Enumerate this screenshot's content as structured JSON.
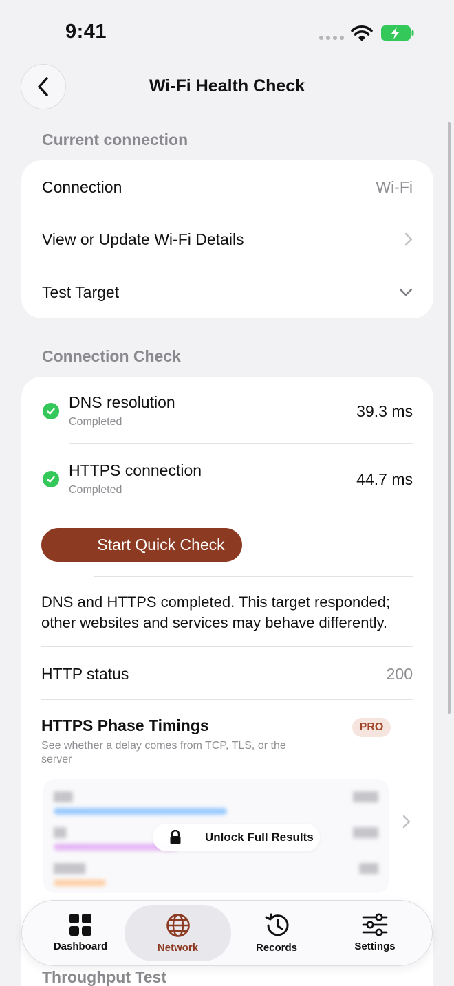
{
  "status_bar": {
    "time": "9:41"
  },
  "nav": {
    "title": "Wi-Fi Health Check",
    "back_icon": "chevron-left-icon"
  },
  "current_connection": {
    "section_label": "Current connection",
    "rows": [
      {
        "label": "Connection",
        "value": "Wi-Fi"
      },
      {
        "label": "View or Update Wi-Fi Details",
        "value": ""
      },
      {
        "label": "Test Target",
        "value": ""
      }
    ]
  },
  "connection_check": {
    "section_label": "Connection Check",
    "items": [
      {
        "name": "DNS resolution",
        "status": "Completed",
        "time": "39.3 ms"
      },
      {
        "name": "HTTPS connection",
        "status": "Completed",
        "time": "44.7 ms"
      }
    ],
    "button_label": "Start Quick Check",
    "summary": "DNS and HTTPS completed. This target responded; other websites and services may behave differently.",
    "http_status_label": "HTTP status",
    "http_status_value": "200",
    "phase_timings": {
      "title": "HTTPS Phase Timings",
      "badge": "PRO",
      "description": "See whether a delay comes from TCP, TLS, or the server",
      "unlock_label": "Unlock Full Results"
    }
  },
  "tab_bar": {
    "tabs": [
      {
        "label": "Dashboard",
        "icon": "grid-icon"
      },
      {
        "label": "Network",
        "icon": "globe-icon"
      },
      {
        "label": "Records",
        "icon": "history-icon"
      },
      {
        "label": "Settings",
        "icon": "sliders-icon"
      }
    ]
  },
  "next_section_label": "Throughput Test",
  "colors": {
    "accent": "#8d3a22",
    "success": "#34c759",
    "background": "#f2f2f5"
  }
}
